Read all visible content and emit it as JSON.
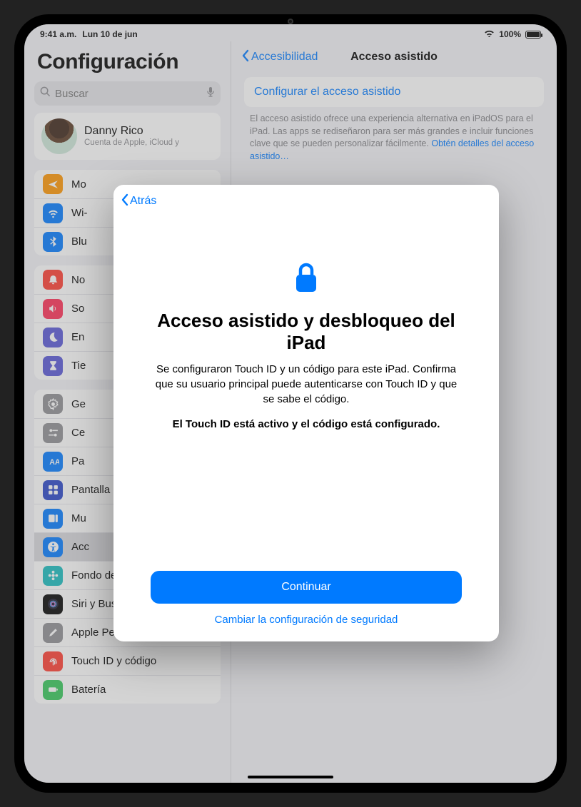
{
  "status": {
    "time": "9:41 a.m.",
    "date": "Lun 10 de jun",
    "battery_pct": "100%"
  },
  "sidebar": {
    "title": "Configuración",
    "search_placeholder": "Buscar",
    "profile": {
      "name": "Danny Rico",
      "sub": "Cuenta de Apple, iCloud y"
    },
    "group1": [
      {
        "label": "Mo",
        "color": "#ff9500",
        "icon": "airplane"
      },
      {
        "label": "Wi-",
        "color": "#007aff",
        "icon": "wifi"
      },
      {
        "label": "Blu",
        "color": "#007aff",
        "icon": "bluetooth"
      }
    ],
    "group2": [
      {
        "label": "No",
        "color": "#ff3b30",
        "icon": "bell"
      },
      {
        "label": "So",
        "color": "#ff2d55",
        "icon": "speaker"
      },
      {
        "label": "En",
        "color": "#5856d6",
        "icon": "moon"
      },
      {
        "label": "Tie",
        "color": "#5856d6",
        "icon": "hourglass"
      }
    ],
    "group3": [
      {
        "label": "Ge",
        "color": "#8e8e93",
        "icon": "gear"
      },
      {
        "label": "Ce",
        "color": "#8e8e93",
        "icon": "switches"
      },
      {
        "label": "Pa",
        "color": "#007aff",
        "icon": "brightness"
      },
      {
        "label": "Pantalla de inicio y biblioteca",
        "color": "#2845c8",
        "icon": "grid"
      },
      {
        "label": "Mu",
        "color": "#007aff",
        "icon": "multitask"
      },
      {
        "label": "Acc",
        "color": "#007aff",
        "icon": "accessibility",
        "selected": true
      },
      {
        "label": "Fondo de pantalla",
        "color": "#17bbbf",
        "icon": "flower"
      },
      {
        "label": "Siri y Buscar",
        "color": "siri",
        "icon": "siri"
      },
      {
        "label": "Apple Pencil",
        "color": "#8e8e93",
        "icon": "pencil"
      },
      {
        "label": "Touch ID y código",
        "color": "#ff3b30",
        "icon": "fingerprint"
      },
      {
        "label": "Batería",
        "color": "#34c759",
        "icon": "battery"
      }
    ]
  },
  "detail": {
    "back": "Accesibilidad",
    "title": "Acceso asistido",
    "button": "Configurar el acceso asistido",
    "helper": "El acceso asistido ofrece una experiencia alternativa en iPadOS para el iPad. Las apps se rediseñaron para ser más grandes e incluir funciones clave que se pueden personalizar fácilmente.",
    "helper_link": "Obtén detalles del acceso asistido…"
  },
  "modal": {
    "back": "Atrás",
    "heading": "Acceso asistido y desbloqueo del iPad",
    "paragraph": "Se configuraron Touch ID y un código para este iPad. Confirma que su usuario principal puede autenticarse con Touch ID y que se sabe el código.",
    "status_line": "El Touch ID está activo y el código está configurado.",
    "primary": "Continuar",
    "secondary": "Cambiar la configuración de seguridad"
  }
}
